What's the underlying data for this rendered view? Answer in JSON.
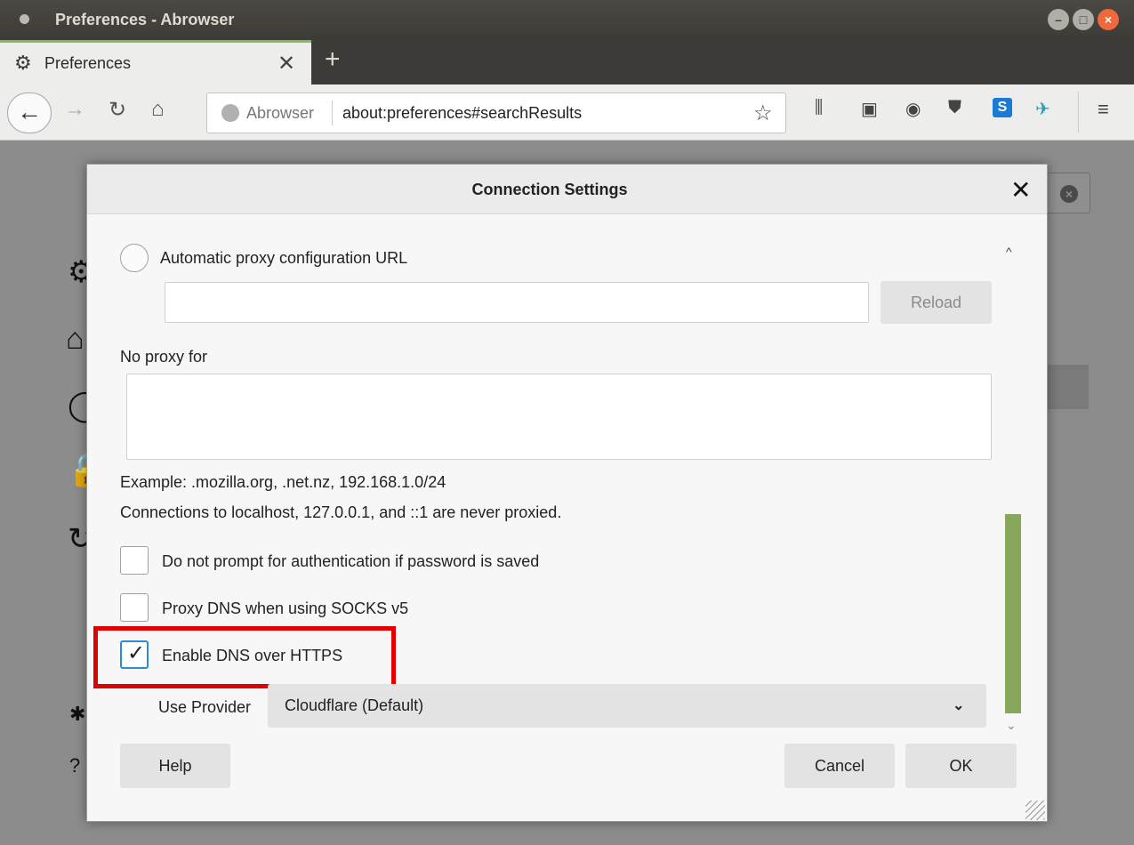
{
  "window": {
    "title": "Preferences - Abrowser"
  },
  "tab": {
    "title": "Preferences",
    "close": "✕",
    "new_tab": "+"
  },
  "urlbar": {
    "site": "Abrowser",
    "url": "about:preferences#searchResults"
  },
  "dialog": {
    "title": "Connection Settings",
    "close": "✕",
    "auto_proxy_label": "Automatic proxy configuration URL",
    "auto_proxy_value": "",
    "reload_label": "Reload",
    "no_proxy_label": "No proxy for",
    "no_proxy_value": "",
    "example_text": "Example: .mozilla.org, .net.nz, 192.168.1.0/24",
    "localhost_text": "Connections to localhost, 127.0.0.1, and ::1 are never proxied.",
    "checkboxes": [
      {
        "label": "Do not prompt for authentication if password is saved",
        "checked": false
      },
      {
        "label": "Proxy DNS when using SOCKS v5",
        "checked": false
      },
      {
        "label": "Enable DNS over HTTPS",
        "checked": true
      }
    ],
    "provider_label": "Use Provider",
    "provider_value": "Cloudflare (Default)",
    "help_label": "Help",
    "cancel_label": "Cancel",
    "ok_label": "OK"
  },
  "colors": {
    "highlight": "#e00000",
    "scroll_thumb": "#87a75a",
    "tab_accent": "#8ab65c"
  }
}
